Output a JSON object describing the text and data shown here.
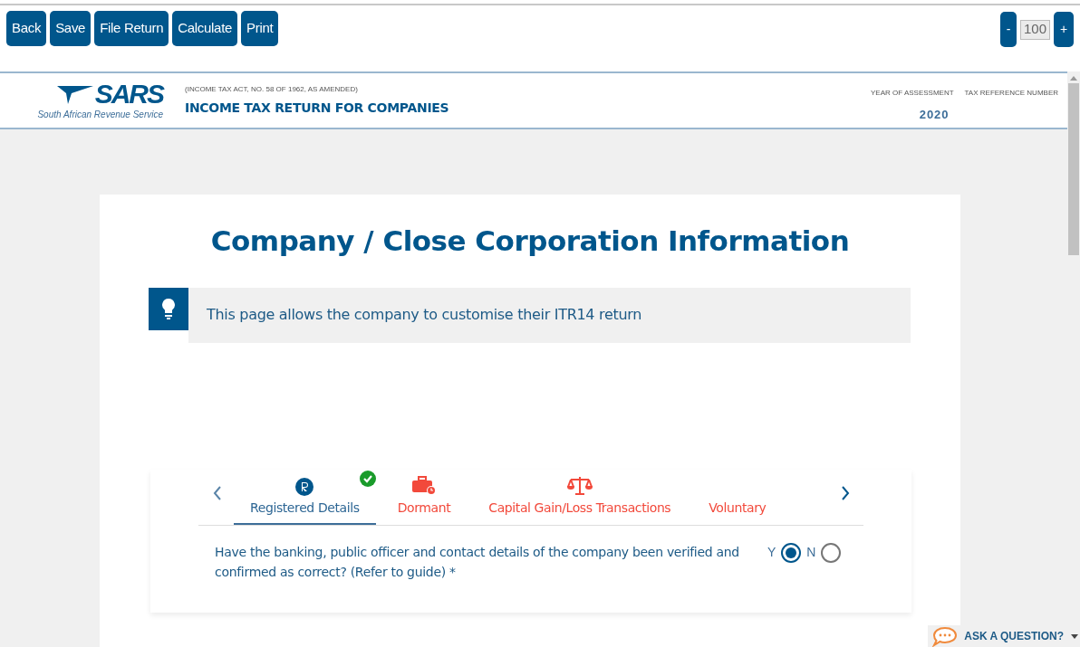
{
  "toolbar": {
    "buttons": [
      "Back",
      "Save",
      "File Return",
      "Calculate",
      "Print"
    ],
    "zoom": {
      "minus": "-",
      "value": "100",
      "plus": "+"
    }
  },
  "header": {
    "logo_text": "SARS",
    "logo_subtitle": "South African Revenue Service",
    "act": "(INCOME TAX ACT, NO. 58 OF 1962, AS AMENDED)",
    "title": "INCOME TAX RETURN FOR COMPANIES",
    "year_label": "YEAR OF ASSESSMENT",
    "year": "2020",
    "tax_ref_label": "TAX REFERENCE NUMBER"
  },
  "page": {
    "title": "Company / Close Corporation Information",
    "info": "This page allows the company to customise their ITR14 return"
  },
  "tabs": [
    {
      "label": "Registered Details",
      "kind": "registered",
      "selected": true,
      "complete": true
    },
    {
      "label": "Dormant",
      "kind": "briefcase",
      "selected": false,
      "complete": false
    },
    {
      "label": "Capital Gain/Loss Transactions",
      "kind": "scale",
      "selected": false,
      "complete": false
    },
    {
      "label": "Voluntary",
      "kind": "none",
      "selected": false,
      "complete": false
    }
  ],
  "question": {
    "text": "Have the banking, public officer and contact details of the company been verified and confirmed as correct? (Refer to guide) *",
    "options": [
      {
        "label": "Y",
        "selected": true
      },
      {
        "label": "N",
        "selected": false
      }
    ]
  },
  "help": {
    "label": "ASK A QUESTION?"
  }
}
